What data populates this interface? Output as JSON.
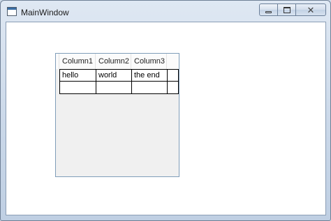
{
  "window": {
    "title": "MainWindow",
    "close_glyph": "✕"
  },
  "grid": {
    "columns": [
      "Column1",
      "Column2",
      "Column3"
    ],
    "rows": [
      [
        "hello",
        "world",
        "the end",
        ""
      ],
      [
        "",
        "",
        "",
        ""
      ]
    ]
  }
}
